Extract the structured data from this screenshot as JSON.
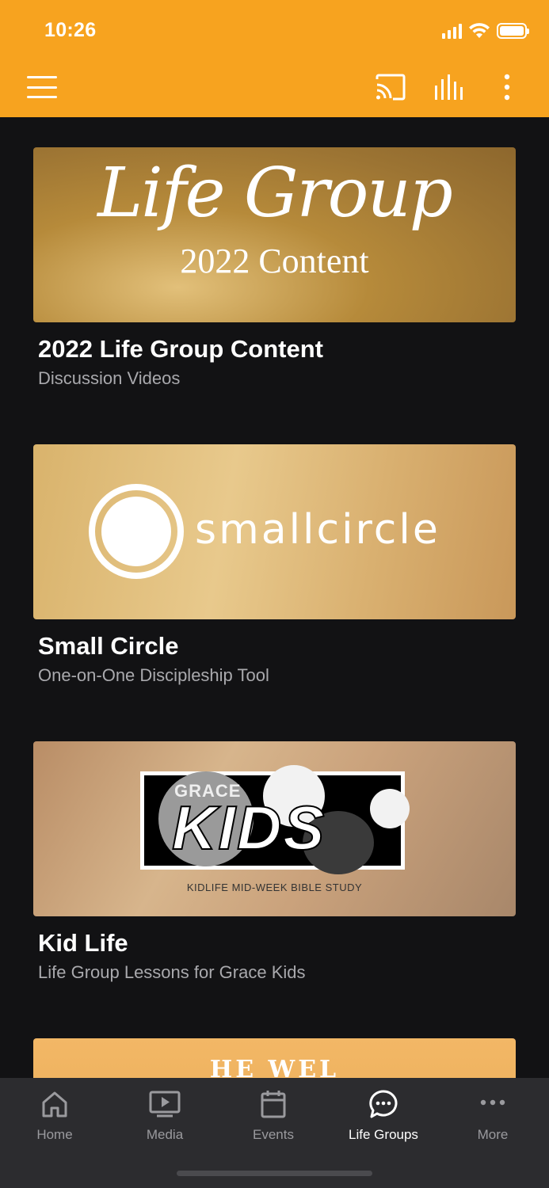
{
  "status_bar": {
    "time": "10:26"
  },
  "app_bar": {
    "icons": [
      "menu-icon",
      "cast-icon",
      "equalizer-icon",
      "more-vertical-icon"
    ]
  },
  "cards": [
    {
      "title": "2022 Life Group Content",
      "subtitle": "Discussion Videos",
      "thumb": {
        "script": "Life Group",
        "sub": "2022 Content"
      }
    },
    {
      "title": "Small Circle",
      "subtitle": "One-on-One Discipleship Tool",
      "thumb": {
        "wordmark": "smallcircle"
      }
    },
    {
      "title": "Kid Life",
      "subtitle": "Life Group Lessons for Grace Kids",
      "thumb": {
        "brand": "GRACE",
        "main": "KIDS",
        "tagline": "KIDLIFE MID-WEEK BIBLE STUDY"
      }
    },
    {
      "title": "",
      "subtitle": "",
      "thumb": {
        "partial": "HE WEL"
      }
    }
  ],
  "tabs": [
    {
      "label": "Home",
      "icon": "home-icon",
      "active": false
    },
    {
      "label": "Media",
      "icon": "media-icon",
      "active": false
    },
    {
      "label": "Events",
      "icon": "calendar-icon",
      "active": false
    },
    {
      "label": "Life Groups",
      "icon": "chat-bubble-icon",
      "active": true
    },
    {
      "label": "More",
      "icon": "more-horizontal-icon",
      "active": false
    }
  ],
  "colors": {
    "accent": "#f7a31f",
    "background": "#121214",
    "tabbar": "#2c2c2f",
    "subtitle": "#a9a9ad"
  }
}
